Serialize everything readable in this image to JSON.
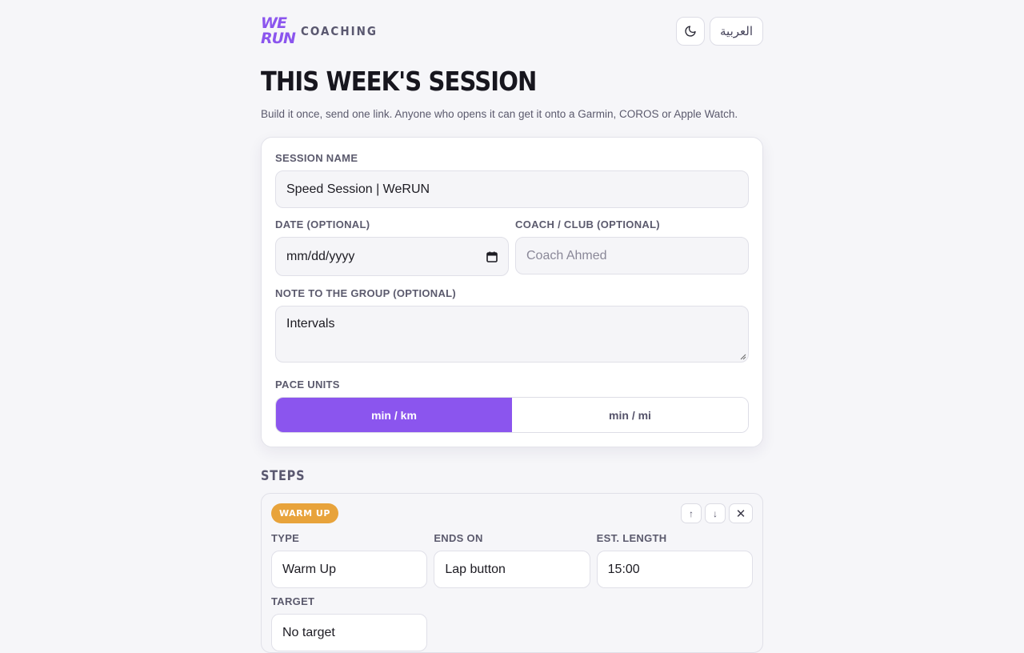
{
  "brand": {
    "logo_top": "WE",
    "logo_bottom": "RUN",
    "subtitle": "COACHING"
  },
  "header": {
    "language_label": "العربية",
    "theme_icon": "moon-icon"
  },
  "page": {
    "title": "THIS WEEK'S SESSION",
    "subtitle": "Build it once, send one link. Anyone who opens it can get it onto a Garmin, COROS or Apple Watch."
  },
  "form": {
    "session_name_label": "SESSION NAME",
    "session_name_value": "Speed Session | WeRUN",
    "date_label": "DATE (OPTIONAL)",
    "date_value": "mm/dd/yyyy",
    "coach_label": "COACH / CLUB (OPTIONAL)",
    "coach_placeholder": "Coach Ahmed",
    "note_label": "NOTE TO THE GROUP (OPTIONAL)",
    "note_value": "Intervals",
    "pace_label": "PACE UNITS",
    "pace_options": [
      "min / km",
      "min / mi"
    ],
    "pace_selected": "min / km"
  },
  "steps": {
    "heading": "STEPS",
    "items": [
      {
        "badge": "WARM UP",
        "badge_color": "#e8a33b",
        "type_label": "TYPE",
        "type_value": "Warm Up",
        "ends_label": "ENDS ON",
        "ends_value": "Lap button",
        "length_label": "EST. LENGTH",
        "length_value": "15:00",
        "target_label": "TARGET",
        "target_value": "No target",
        "move_up": "↑",
        "move_down": "↓",
        "remove": "✕"
      }
    ]
  },
  "colors": {
    "accent": "#8b55ee",
    "warmup": "#e8a33b",
    "background": "#f6f6f9"
  }
}
